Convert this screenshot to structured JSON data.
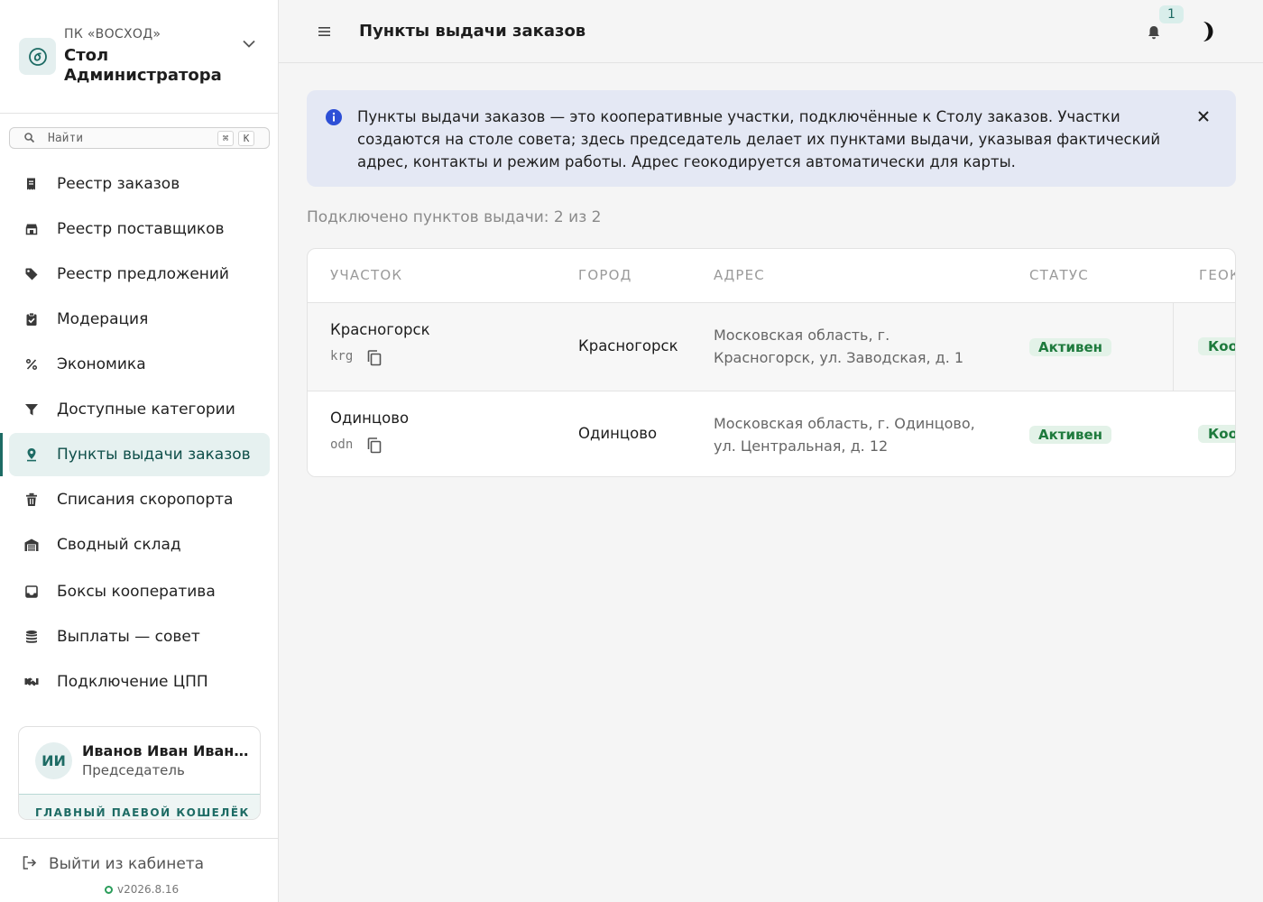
{
  "app": {
    "org_subtitle": "ПК «ВОСХОД»",
    "org_title": "Стол Администратора"
  },
  "search": {
    "placeholder": "Найти",
    "shortcut_mod": "⌘",
    "shortcut_key": "K"
  },
  "sidebar": {
    "items": [
      {
        "label": "Реестр заказов",
        "icon": "receipt-icon"
      },
      {
        "label": "Реестр поставщиков",
        "icon": "store-icon"
      },
      {
        "label": "Реестр предложений",
        "icon": "tag-icon"
      },
      {
        "label": "Модерация",
        "icon": "clipboard-check-icon"
      },
      {
        "label": "Экономика",
        "icon": "percent-icon"
      },
      {
        "label": "Доступные категории",
        "icon": "filter-icon"
      },
      {
        "label": "Пункты выдачи заказов",
        "icon": "location-pin-icon",
        "active": true
      },
      {
        "label": "Списания скоропорта",
        "icon": "trash-icon"
      },
      {
        "label": "Сводный склад",
        "icon": "warehouse-icon"
      },
      {
        "label": "Боксы кооператива",
        "icon": "inbox-icon"
      },
      {
        "label": "Выплаты — совет",
        "icon": "coins-icon"
      },
      {
        "label": "Подключение ЦПП",
        "icon": "handshake-icon"
      }
    ]
  },
  "user": {
    "initials": "ИИ",
    "name": "Иванов Иван Иванович",
    "role": "Председатель",
    "wallet_label": "ГЛАВНЫЙ ПАЕВОЙ КОШЕЛЁК"
  },
  "footer": {
    "logout_label": "Выйти из кабинета",
    "version": "v2026.8.16"
  },
  "header": {
    "page_title": "Пункты выдачи заказов",
    "notifications_count": "1"
  },
  "banner": {
    "text": "Пункты выдачи заказов — это кооперативные участки, подключённые к Столу заказов. Участки создаются на столе совета; здесь председатель делает их пунктами выдачи, указывая фактический адрес, контакты и режим работы. Адрес геокодируется автоматически для карты."
  },
  "summary": {
    "count_text": "Подключено пунктов выдачи: 2 из 2"
  },
  "table": {
    "columns": [
      "УЧАСТОК",
      "ГОРОД",
      "АДРЕС",
      "СТАТУС",
      "ГЕОК"
    ],
    "rows": [
      {
        "name": "Красногорск",
        "code": "krg",
        "city": "Красногорск",
        "address": "Московская область, г. Красногорск, ул. Заводская, д. 1",
        "status": "Активен",
        "geo": "Коор"
      },
      {
        "name": "Одинцово",
        "code": "odn",
        "city": "Одинцово",
        "address": "Московская область, г. Одинцово, ул. Центральная, д. 12",
        "status": "Активен",
        "geo": "Коор"
      }
    ]
  },
  "colors": {
    "accent": "#1d6b64",
    "active_bg": "#e6f1f0",
    "status_green": "#1e7a3d",
    "info_banner_bg": "#e4e8f4",
    "info_icon": "#2d4fd6"
  }
}
